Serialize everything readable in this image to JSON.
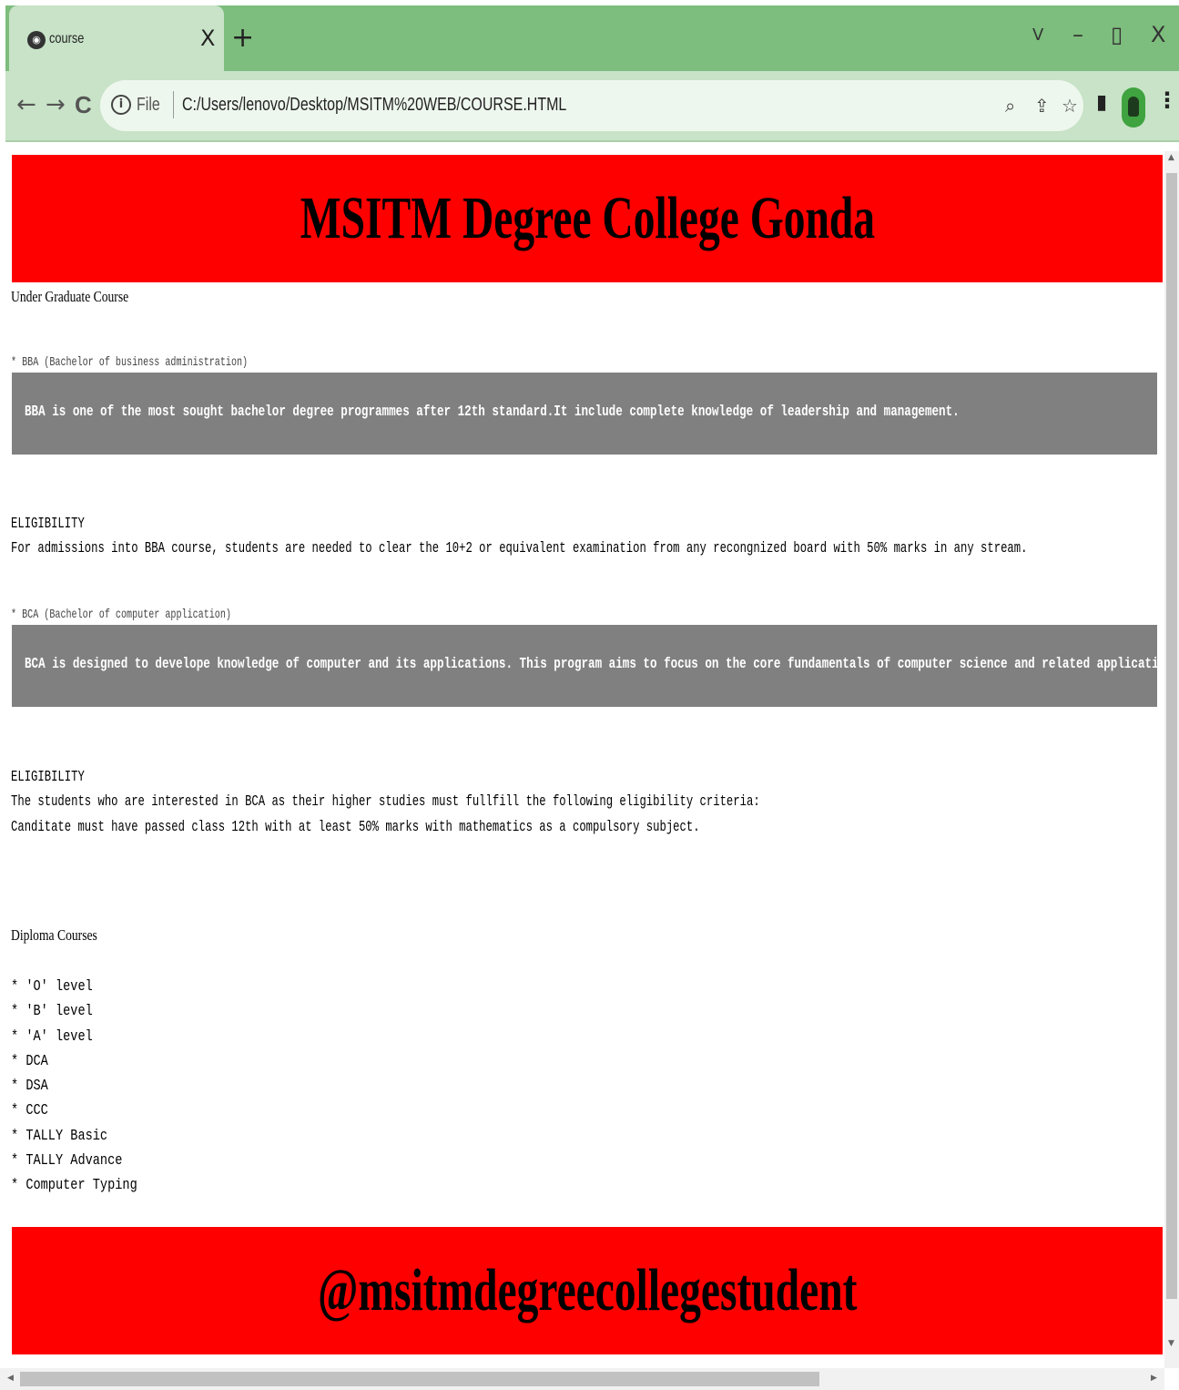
{
  "browser": {
    "tab_title": "course",
    "tab_close": "X",
    "new_tab": "+",
    "win_controls": {
      "tabsearch": "V",
      "minimize": "–",
      "maximize": "▯",
      "close": "X"
    },
    "nav": {
      "back": "←",
      "forward": "→",
      "reload": "C"
    },
    "omnibox": {
      "info": "i",
      "scheme_label": "File",
      "url": "C:/Users/lenovo/Desktop/MSITM%20WEB/COURSE.HTML"
    },
    "icons": {
      "zoom": "zoom-icon",
      "share": "share-icon",
      "bookmark": "star-icon",
      "sidepanel": "side-panel-icon",
      "profile": "profile-icon",
      "menu": "kebab-menu-icon"
    }
  },
  "page": {
    "header": "MSITM Degree College Gonda",
    "ug_heading": "Under Graduate Course",
    "bba": {
      "title": "* BBA (Bachelor of business administration)",
      "description": "BBA is one of the most sought bachelor degree programmes after 12th standard.It include complete knowledge of leadership and management.",
      "eligibility_heading": "ELIGIBILITY",
      "eligibility_text": "For admissions into BBA course, students are needed to clear the 10+2 or equivalent examination from any recongnized board with 50% marks in any stream."
    },
    "bca": {
      "title": "* BCA (Bachelor of computer application)",
      "description": "BCA is designed to develope knowledge of computer and its applications. This program aims to focus on the core fundamentals of computer science and related applications. Students who opt for BCA are well equipped t",
      "eligibility_heading": "ELIGIBILITY",
      "eligibility_line1": "The students who are interested in BCA as their higher studies must fullfill the following eligibility criteria:",
      "eligibility_line2": "Canditate must have passed class 12th with at least 50% marks with mathematics as a compulsory subject."
    },
    "diploma_heading": "Diploma Courses",
    "diploma_items": [
      "* 'O' level",
      "* 'B' level",
      "* 'A' level",
      "* DCA",
      "* DSA",
      "* CCC",
      "* TALLY Basic",
      "* TALLY Advance",
      "* Computer Typing"
    ],
    "footer": "@msitmdegreecollegestudent"
  },
  "colors": {
    "banner": "#ff0000",
    "desc_box": "#808080",
    "tabbar": "#7dbd7d",
    "toolbar": "#c8e3c8"
  }
}
